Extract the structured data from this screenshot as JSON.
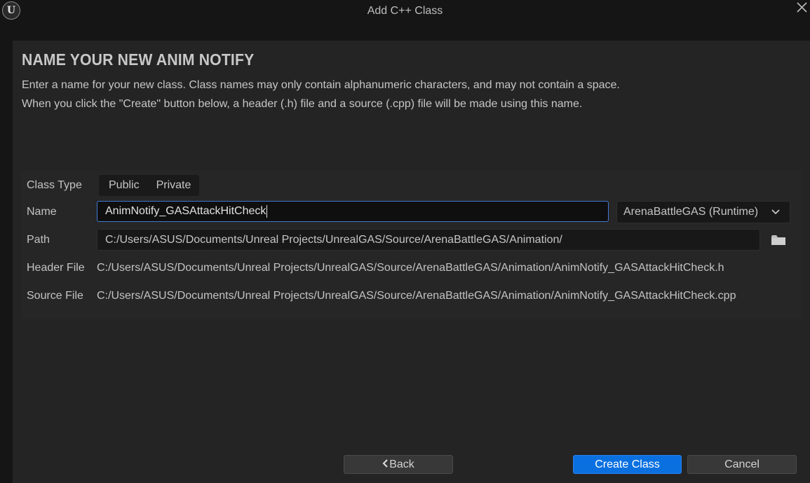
{
  "window": {
    "title": "Add C++ Class",
    "logo_letter": "U",
    "accent_color": "#0a70e0"
  },
  "heading": "NAME YOUR NEW ANIM NOTIFY",
  "description": {
    "line1": "Enter a name for your new class. Class names may only contain alphanumeric characters, and may not contain a space.",
    "line2": "When you click the \"Create\" button below, a header (.h) file and a source (.cpp) file will be made using this name."
  },
  "form": {
    "class_type": {
      "label": "Class Type",
      "options": [
        "Public",
        "Private"
      ]
    },
    "name": {
      "label": "Name",
      "value": "AnimNotify_GASAttackHitCheck"
    },
    "module": {
      "selected": "ArenaBattleGAS (Runtime)",
      "icon": "chevron-down-icon"
    },
    "path": {
      "label": "Path",
      "value": "C:/Users/ASUS/Documents/Unreal Projects/UnrealGAS/Source/ArenaBattleGAS/Animation/",
      "browse_icon": "folder-icon"
    },
    "header_file": {
      "label": "Header File",
      "value": "C:/Users/ASUS/Documents/Unreal Projects/UnrealGAS/Source/ArenaBattleGAS/Animation/AnimNotify_GASAttackHitCheck.h"
    },
    "source_file": {
      "label": "Source File",
      "value": "C:/Users/ASUS/Documents/Unreal Projects/UnrealGAS/Source/ArenaBattleGAS/Animation/AnimNotify_GASAttackHitCheck.cpp"
    }
  },
  "buttons": {
    "back": "Back",
    "create": "Create Class",
    "cancel": "Cancel"
  }
}
